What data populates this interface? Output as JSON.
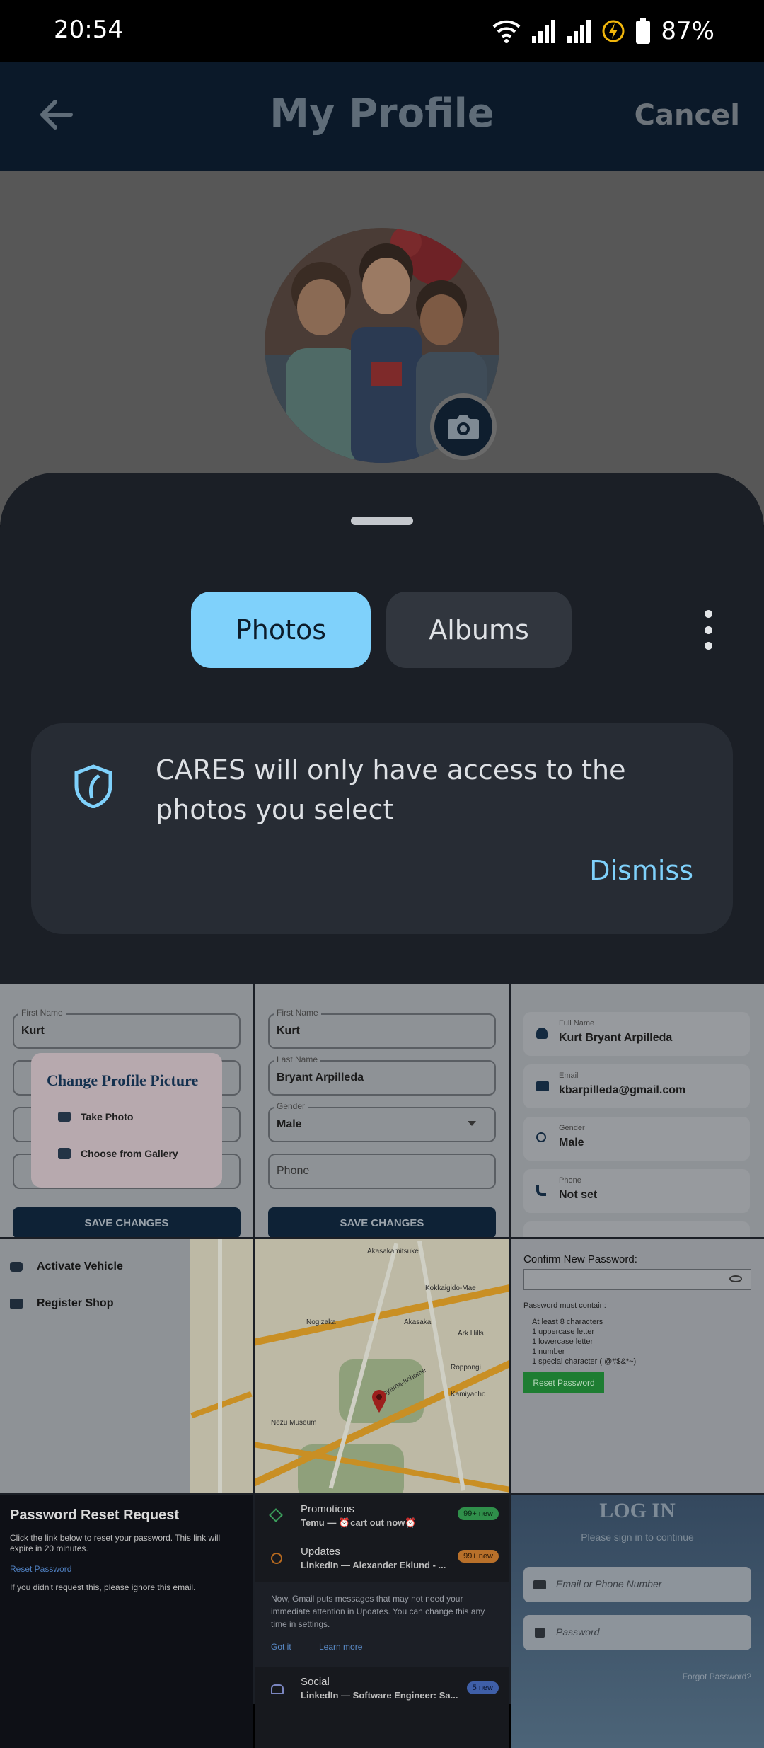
{
  "status_bar": {
    "time": "20:54",
    "battery": "87%"
  },
  "header": {
    "title": "My Profile",
    "cancel": "Cancel"
  },
  "picker": {
    "tabs": [
      {
        "label": "Photos"
      },
      {
        "label": "Albums"
      }
    ],
    "notice_text": "CARES will only have access to the photos you select",
    "dismiss": "Dismiss"
  },
  "thumbnails": {
    "t1": {
      "first_name_label": "First Name",
      "first_name": "Kurt",
      "dialog_title": "Change Profile Picture",
      "take_photo": "Take Photo",
      "choose_gallery": "Choose from Gallery",
      "button": "SAVE CHANGES"
    },
    "t2": {
      "first_name_label": "First Name",
      "first_name": "Kurt",
      "last_name_label": "Last Name",
      "last_name": "Bryant Arpilleda",
      "gender_label": "Gender",
      "gender": "Male",
      "phone_placeholder": "Phone",
      "button": "SAVE CHANGES"
    },
    "t3": {
      "full_name_label": "Full Name",
      "full_name": "Kurt Bryant Arpilleda",
      "email_label": "Email",
      "email": "kbarpilleda@gmail.com",
      "gender_label": "Gender",
      "gender": "Male",
      "phone_label": "Phone",
      "phone": "Not set"
    },
    "t4": {
      "activate": "Activate Vehicle",
      "register": "Register Shop"
    },
    "t5": {
      "labels": [
        "Akasakamitsuke",
        "Kokkaigido-Mae",
        "Akasaka",
        "Ark Hills",
        "Nogizaka",
        "Roppongi",
        "Kamiyacho",
        "Nezu Museum",
        "Aoyama-Itchome"
      ]
    },
    "t6": {
      "confirm_label": "Confirm New Password:",
      "must_contain": "Password must contain:",
      "rules": [
        "At least 8 characters",
        "1 uppercase letter",
        "1 lowercase letter",
        "1 number",
        "1 special character (!@#$&*~)"
      ],
      "button": "Reset Password"
    },
    "t7": {
      "title": "Password Reset Request",
      "body": "Click the link below to reset your password. This link will expire in 20 minutes.",
      "link": "Reset Password",
      "footer": "If you didn't request this, please ignore this email."
    },
    "t8": {
      "promotions": "Promotions",
      "promotions_sub": "Temu — ⏰cart out now⏰",
      "promotions_badge": "99+ new",
      "updates": "Updates",
      "updates_sub": "LinkedIn — Alexander Eklund - ...",
      "updates_badge": "99+ new",
      "info": "Now, Gmail puts messages that may not need your immediate attention in Updates. You can change this any time in settings.",
      "got_it": "Got it",
      "learn_more": "Learn more",
      "social": "Social",
      "social_sub": "LinkedIn — Software Engineer: Sa...",
      "social_badge": "5 new"
    },
    "t9": {
      "title": "LOG IN",
      "subtitle": "Please sign in to continue",
      "email_placeholder": "Email or Phone Number",
      "password_placeholder": "Password",
      "forgot": "Forgot Password?"
    }
  }
}
